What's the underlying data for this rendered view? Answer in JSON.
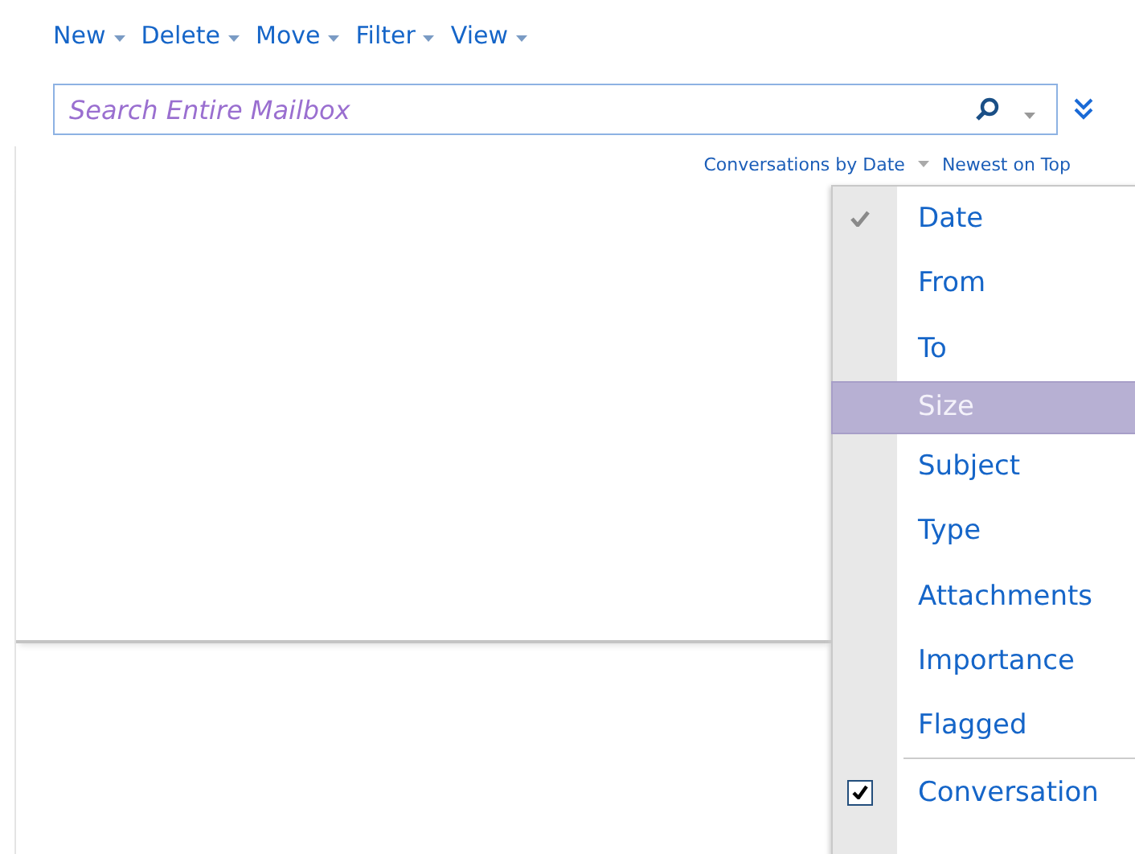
{
  "toolbar": [
    {
      "label": "New"
    },
    {
      "label": "Delete"
    },
    {
      "label": "Move"
    },
    {
      "label": "Filter"
    },
    {
      "label": "View"
    }
  ],
  "search": {
    "placeholder": "Search Entire Mailbox"
  },
  "sort_bar": {
    "arrange": "Conversations by Date",
    "order": "Newest on Top"
  },
  "menu": [
    {
      "label": "Date",
      "kind": "option",
      "checked": true,
      "selected": false
    },
    {
      "label": "From",
      "kind": "option",
      "checked": false,
      "selected": false
    },
    {
      "label": "To",
      "kind": "option",
      "checked": false,
      "selected": false
    },
    {
      "label": "Size",
      "kind": "option",
      "checked": false,
      "selected": true
    },
    {
      "label": "Subject",
      "kind": "option",
      "checked": false,
      "selected": false
    },
    {
      "label": "Type",
      "kind": "option",
      "checked": false,
      "selected": false
    },
    {
      "label": "Attachments",
      "kind": "option",
      "checked": false,
      "selected": false
    },
    {
      "label": "Importance",
      "kind": "option",
      "checked": false,
      "selected": false
    },
    {
      "label": "Flagged",
      "kind": "option",
      "checked": false,
      "selected": false
    },
    {
      "label": "Conversation",
      "kind": "toggle",
      "checked": true,
      "selected": false
    }
  ]
}
